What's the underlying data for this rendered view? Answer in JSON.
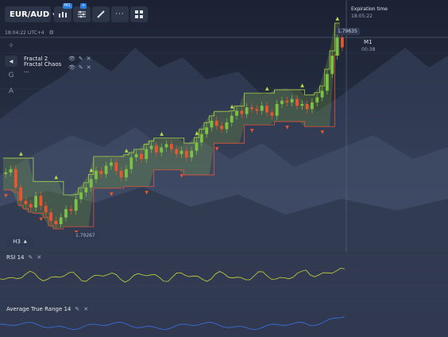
{
  "toolbar": {
    "pair_label": "EUR/AUD",
    "timeframe_badge": "M1",
    "add_badge": "+",
    "icons": [
      "candles-icon",
      "indicators-icon",
      "brush-icon",
      "more-icon",
      "layout-icon"
    ]
  },
  "clock": {
    "time": "18:04:22 UTC+4"
  },
  "sidebar": {
    "items": [
      "A",
      "G",
      "A"
    ]
  },
  "indicators": [
    {
      "name": "Fractal 2"
    },
    {
      "name": "Fractal Chaos ..."
    }
  ],
  "expiration": {
    "title": "Expiration time",
    "time": "18:05:22"
  },
  "price": {
    "current": "1.79635",
    "low_marker": "1.79267",
    "timeframe": "M1",
    "countdown": "00:38"
  },
  "chart_timeframe": "H3",
  "rsi": {
    "label": "RSI 14"
  },
  "atr": {
    "label": "Average True Range 14"
  },
  "colors": {
    "up": "#7cc242",
    "down": "#e8552e",
    "channel": "#8fbf3a",
    "rsi": "#c8d63a",
    "atr": "#3a6cd6",
    "accent": "#2a7de1"
  },
  "chart_data": {
    "type": "candlestick",
    "close": [
      1.7949,
      1.7951,
      1.794,
      1.7932,
      1.793,
      1.7928,
      1.7935,
      1.7929,
      1.7925,
      1.792,
      1.7918,
      1.7922,
      1.7927,
      1.7926,
      1.7933,
      1.7937,
      1.794,
      1.7945,
      1.795,
      1.7948,
      1.7953,
      1.7955,
      1.795,
      1.7946,
      1.7951,
      1.7958,
      1.796,
      1.7957,
      1.7963,
      1.7965,
      1.7961,
      1.7964,
      1.7966,
      1.7963,
      1.796,
      1.7962,
      1.7958,
      1.7962,
      1.7967,
      1.7972,
      1.7976,
      1.798,
      1.7977,
      1.7975,
      1.7979,
      1.7983,
      1.7986,
      1.7984,
      1.7988,
      1.7987,
      1.7986,
      1.7989,
      1.7985,
      1.7983,
      1.799,
      1.7992,
      1.7991,
      1.7993,
      1.7989,
      1.799,
      1.7987,
      1.7991,
      1.7994,
      1.7998,
      1.8008,
      1.8019,
      1.803,
      1.8024
    ],
    "y_reference": [
      1.79267,
      1.79635
    ]
  }
}
